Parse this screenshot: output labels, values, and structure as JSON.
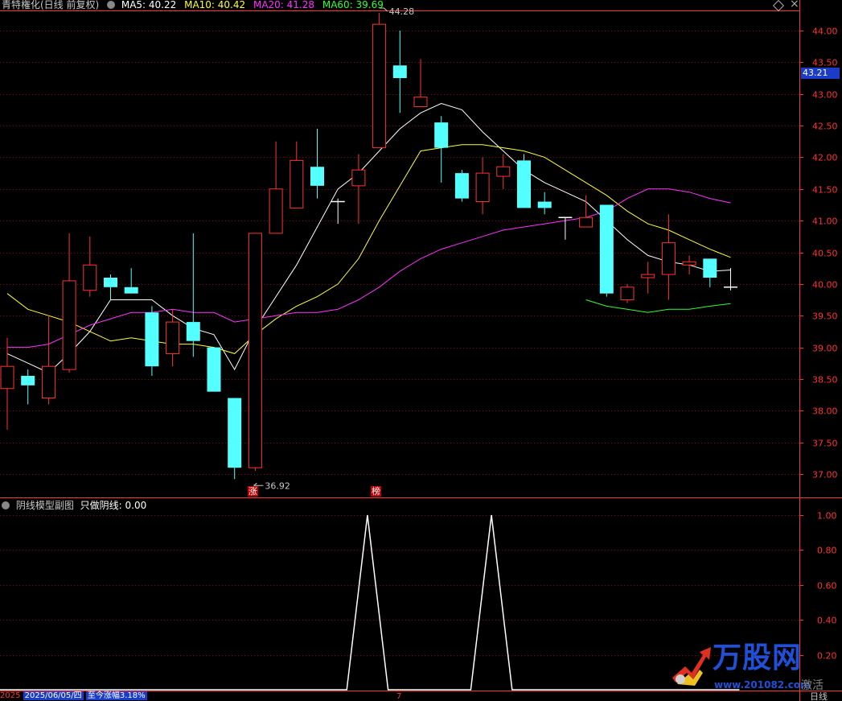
{
  "header": {
    "title": "青特権化(日线 前复权)",
    "indicators": [
      {
        "label": "MA5: 40.22",
        "color": "#ffffff"
      },
      {
        "label": "MA10: 40.42",
        "color": "#ffff32"
      },
      {
        "label": "MA20: 41.28",
        "color": "#ff32ff"
      },
      {
        "label": "MA60: 39.69",
        "color": "#32ff32"
      }
    ]
  },
  "sub_header": {
    "title": "阴线模型副图",
    "value_label": "只做阴线: 0.00"
  },
  "current_price": "43.21",
  "annotations": {
    "high_label": "44.28",
    "low_label": "36.92",
    "mark_zhang": "涨",
    "mark_bang": "榜"
  },
  "bottom": {
    "year": "2025",
    "date": "2025/06/05/四",
    "change": "至今涨幅3.18%",
    "tick7": "7",
    "period": "日线"
  },
  "watermark": {
    "brand": "万股网",
    "site": "www.201082.com",
    "tag": "激活"
  },
  "colors": {
    "up": "#ff3232",
    "down": "#54ffff",
    "grid": "#8c0000",
    "axis": "#ff3232"
  },
  "chart_data": [
    {
      "type": "candlestick",
      "title": "青特権化(日线 前复权)",
      "ylim": [
        36.8,
        44.4
      ],
      "yticks": [
        "44.00",
        "43.50",
        "43.00",
        "42.50",
        "42.00",
        "41.50",
        "41.00",
        "40.50",
        "40.00",
        "39.50",
        "39.00",
        "38.50",
        "38.00",
        "37.50",
        "37.00"
      ],
      "candles": [
        {
          "o": 38.35,
          "h": 39.15,
          "l": 37.7,
          "c": 38.7
        },
        {
          "o": 38.55,
          "h": 38.65,
          "l": 38.1,
          "c": 38.4
        },
        {
          "o": 38.2,
          "h": 39.5,
          "l": 38.1,
          "c": 38.7
        },
        {
          "o": 38.65,
          "h": 40.8,
          "l": 38.6,
          "c": 40.05
        },
        {
          "o": 39.9,
          "h": 40.75,
          "l": 39.8,
          "c": 40.3
        },
        {
          "o": 40.1,
          "h": 40.15,
          "l": 39.75,
          "c": 39.95
        },
        {
          "o": 39.95,
          "h": 40.25,
          "l": 39.85,
          "c": 39.85
        },
        {
          "o": 39.55,
          "h": 39.65,
          "l": 38.55,
          "c": 38.7
        },
        {
          "o": 38.9,
          "h": 39.6,
          "l": 38.7,
          "c": 39.4
        },
        {
          "o": 39.4,
          "h": 40.8,
          "l": 38.85,
          "c": 39.1
        },
        {
          "o": 39.0,
          "h": 39.0,
          "l": 38.3,
          "c": 38.3
        },
        {
          "o": 38.2,
          "h": 38.2,
          "l": 36.92,
          "c": 37.1
        },
        {
          "o": 37.1,
          "h": 40.8,
          "l": 37.05,
          "c": 40.8
        },
        {
          "o": 40.8,
          "h": 42.25,
          "l": 40.8,
          "c": 41.5
        },
        {
          "o": 41.2,
          "h": 42.25,
          "l": 41.2,
          "c": 41.95
        },
        {
          "o": 41.85,
          "h": 42.45,
          "l": 41.35,
          "c": 41.55
        },
        {
          "o": 41.3,
          "h": 41.35,
          "l": 40.95,
          "c": 41.3
        },
        {
          "o": 41.55,
          "h": 42.05,
          "l": 40.95,
          "c": 41.8
        },
        {
          "o": 42.15,
          "h": 44.28,
          "l": 42.15,
          "c": 44.1
        },
        {
          "o": 43.45,
          "h": 44.0,
          "l": 42.7,
          "c": 43.25
        },
        {
          "o": 42.8,
          "h": 43.55,
          "l": 42.8,
          "c": 42.95
        },
        {
          "o": 42.55,
          "h": 42.65,
          "l": 41.6,
          "c": 42.15
        },
        {
          "o": 41.75,
          "h": 41.8,
          "l": 41.3,
          "c": 41.35
        },
        {
          "o": 41.3,
          "h": 42.0,
          "l": 41.1,
          "c": 41.75
        },
        {
          "o": 41.7,
          "h": 42.05,
          "l": 41.5,
          "c": 41.85
        },
        {
          "o": 41.95,
          "h": 42.05,
          "l": 41.2,
          "c": 41.2
        },
        {
          "o": 41.3,
          "h": 41.45,
          "l": 41.1,
          "c": 41.2
        },
        {
          "o": 41.05,
          "h": 41.05,
          "l": 40.7,
          "c": 41.05
        },
        {
          "o": 40.9,
          "h": 41.4,
          "l": 40.9,
          "c": 41.05
        },
        {
          "o": 41.25,
          "h": 41.25,
          "l": 39.8,
          "c": 39.85
        },
        {
          "o": 39.75,
          "h": 40.0,
          "l": 39.7,
          "c": 39.95
        },
        {
          "o": 40.1,
          "h": 40.35,
          "l": 39.85,
          "c": 40.15
        },
        {
          "o": 40.15,
          "h": 41.1,
          "l": 39.75,
          "c": 40.65
        },
        {
          "o": 40.3,
          "h": 40.45,
          "l": 40.15,
          "c": 40.35
        },
        {
          "o": 40.4,
          "h": 40.4,
          "l": 39.95,
          "c": 40.1
        },
        {
          "o": 39.95,
          "h": 40.25,
          "l": 39.9,
          "c": 39.95
        }
      ],
      "series": [
        {
          "name": "MA5",
          "color": "#ffffff",
          "values": [
            38.9,
            38.75,
            38.6,
            38.9,
            39.25,
            39.75,
            39.75,
            39.75,
            39.5,
            39.3,
            39.2,
            38.65,
            39.3,
            39.8,
            40.3,
            40.9,
            41.5,
            41.75,
            42.1,
            42.45,
            42.7,
            42.85,
            42.75,
            42.4,
            42.1,
            41.8,
            41.6,
            41.45,
            41.3,
            41.0,
            40.7,
            40.45,
            40.35,
            40.3,
            40.2,
            40.22
          ]
        },
        {
          "name": "MA10",
          "color": "#ffff32",
          "values": [
            39.85,
            39.6,
            39.5,
            39.4,
            39.25,
            39.1,
            39.15,
            39.1,
            39.05,
            39.05,
            39.0,
            38.9,
            39.2,
            39.45,
            39.65,
            39.8,
            40.0,
            40.4,
            41.0,
            41.55,
            42.1,
            42.15,
            42.2,
            42.2,
            42.15,
            42.1,
            42.0,
            41.8,
            41.6,
            41.4,
            41.15,
            40.95,
            40.85,
            40.7,
            40.55,
            40.42
          ]
        },
        {
          "name": "MA20",
          "color": "#ff32ff",
          "values": [
            39.0,
            39.0,
            39.05,
            39.2,
            39.35,
            39.45,
            39.55,
            39.55,
            39.6,
            39.55,
            39.55,
            39.4,
            39.45,
            39.5,
            39.55,
            39.55,
            39.6,
            39.75,
            39.95,
            40.2,
            40.4,
            40.55,
            40.65,
            40.75,
            40.85,
            40.9,
            40.95,
            41.0,
            41.05,
            41.15,
            41.35,
            41.5,
            41.5,
            41.45,
            41.35,
            41.28
          ]
        },
        {
          "name": "MA60",
          "color": "#32ff32",
          "values": [
            null,
            null,
            null,
            null,
            null,
            null,
            null,
            null,
            null,
            null,
            null,
            null,
            null,
            null,
            null,
            null,
            null,
            null,
            null,
            null,
            null,
            null,
            null,
            null,
            null,
            null,
            null,
            null,
            39.75,
            39.65,
            39.6,
            39.55,
            39.6,
            39.6,
            39.65,
            39.69
          ]
        }
      ]
    },
    {
      "type": "line",
      "title": "阴线模型副图",
      "ylim": [
        0,
        1.05
      ],
      "yticks": [
        "1.00",
        "0.80",
        "0.60",
        "0.40",
        "0.20"
      ],
      "values": [
        0,
        0,
        0,
        0,
        0,
        0,
        0,
        0,
        0,
        0,
        0,
        0,
        0,
        0,
        0,
        0,
        0,
        1,
        0,
        0,
        0,
        0,
        0,
        1,
        0,
        0,
        0,
        0,
        0,
        0,
        0,
        0,
        0,
        0,
        0,
        0
      ],
      "color": "#ffffff"
    }
  ]
}
